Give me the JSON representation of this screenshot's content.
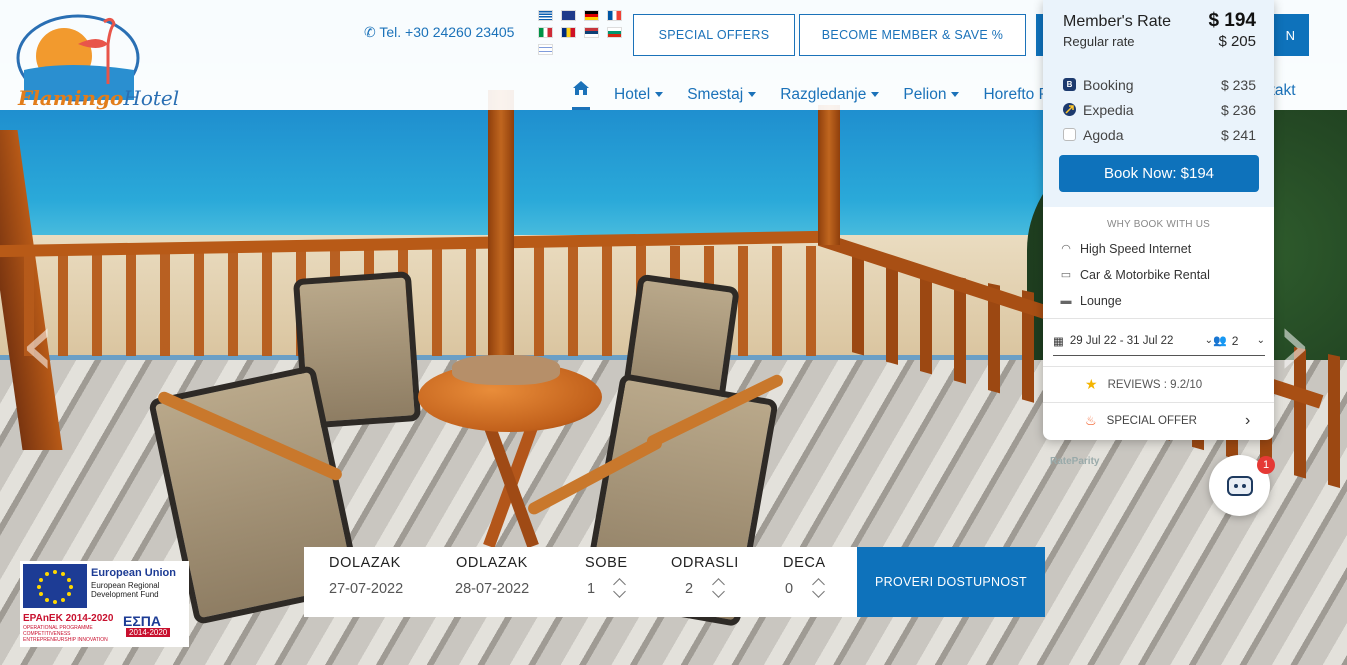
{
  "header": {
    "logo_main": "Flamingo",
    "logo_sub": "Hotel",
    "phone": "Tel. +30 24260 23405",
    "special_offers": "SPECIAL OFFERS",
    "become_member": "BECOME MEMBER & SAVE %",
    "hidden_button_tail": "N",
    "nav": [
      "Hotel",
      "Smestaj",
      "Razgledanje",
      "Pelion",
      "Horefto Pe"
    ],
    "nav_contact": "ntakt",
    "flags": [
      "greek-flag",
      "uk-flag",
      "german-flag",
      "french-flag",
      "italian-flag",
      "romanian-flag",
      "serbian-flag",
      "bulgarian-flag",
      "israeli-flag"
    ]
  },
  "widget": {
    "member_label": "Member's Rate",
    "member_price": "$ 194",
    "regular_label": "Regular rate",
    "regular_price": "$ 205",
    "otas": [
      {
        "name": "Booking",
        "price": "$ 235",
        "icon": "B"
      },
      {
        "name": "Expedia",
        "price": "$ 236",
        "icon": ""
      },
      {
        "name": "Agoda",
        "price": "$ 241",
        "icon": ""
      }
    ],
    "book_now": "Book Now: $194",
    "why": "WHY BOOK WITH US",
    "features": [
      "High Speed Internet",
      "Car & Motorbike Rental",
      "Lounge"
    ],
    "dates": "29 Jul 22 - 31 Jul 22",
    "guests": "2",
    "reviews": "REVIEWS : 9.2/10",
    "special_offer": "SPECIAL OFFER",
    "powered": "RateParity"
  },
  "bot": {
    "badge": "1"
  },
  "booking": {
    "arrival_label": "DOLAZAK",
    "arrival_value": "27-07-2022",
    "departure_label": "ODLAZAK",
    "departure_value": "28-07-2022",
    "rooms_label": "SOBE",
    "rooms_value": "1",
    "adults_label": "ODRASLI",
    "adults_value": "2",
    "children_label": "DECA",
    "children_value": "0",
    "check_button": "PROVERI DOSTUPNOST"
  },
  "eu_badge": {
    "title": "European Union",
    "subtitle": "European Regional Development Fund",
    "epanek": "EPAnEK 2014-2020",
    "epanek_sub": "OPERATIONAL PROGRAMME COMPETITIVENESS ENTREPRENEURSHIP INNOVATION",
    "espa": "ΕΣΠΑ",
    "espa_years": "2014-2020"
  },
  "colors": {
    "brand_blue": "#0e72bb",
    "logo_orange": "#e27d1a"
  }
}
